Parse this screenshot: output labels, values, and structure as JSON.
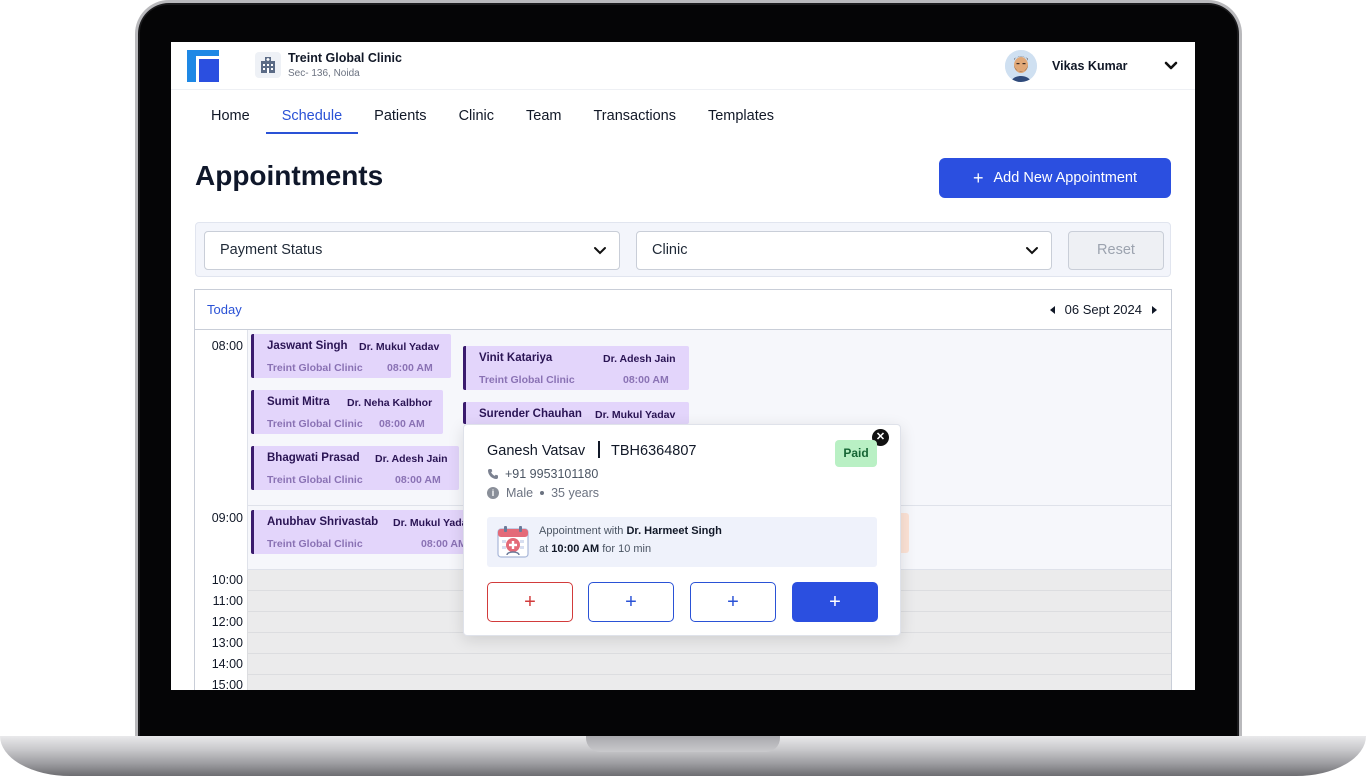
{
  "clinic": {
    "name": "Treint Global Clinic",
    "address": "Sec- 136, Noida"
  },
  "user": {
    "name": "Vikas Kumar"
  },
  "nav": [
    "Home",
    "Schedule",
    "Patients",
    "Clinic",
    "Team",
    "Transactions",
    "Templates"
  ],
  "active_nav": "Schedule",
  "page": {
    "title": "Appointments",
    "add_button": "Add New Appointment"
  },
  "filters": {
    "payment_status": "Payment Status",
    "clinic": "Clinic",
    "reset": "Reset"
  },
  "calendar": {
    "today_label": "Today",
    "date": "06 Sept 2024",
    "times": [
      "08:00",
      "09:00",
      "10:00",
      "11:00",
      "12:00",
      "13:00",
      "14:00",
      "15:00"
    ],
    "appointments": [
      {
        "patient": "Jaswant Singh",
        "doctor": "Dr. Mukul Yadav",
        "clinic": "Treint Global Clinic",
        "time": "08:00 AM"
      },
      {
        "patient": "Vinit Katariya",
        "doctor": "Dr. Adesh Jain",
        "clinic": "Treint Global Clinic",
        "time": "08:00 AM"
      },
      {
        "patient": "Sumit Mitra",
        "doctor": "Dr. Neha Kalbhor",
        "clinic": "Treint Global Clinic",
        "time": "08:00 AM"
      },
      {
        "patient": "Surender Chauhan",
        "doctor": "Dr. Mukul Yadav",
        "clinic": "",
        "time": ""
      },
      {
        "patient": "Bhagwati Prasad",
        "doctor": "Dr. Adesh Jain",
        "clinic": "Treint Global Clinic",
        "time": "08:00 AM"
      },
      {
        "patient": "Anubhav Shrivastab",
        "doctor": "Dr. Mukul Yada",
        "clinic": "Treint Global Clinic",
        "time": "08:00 AM"
      }
    ]
  },
  "popup": {
    "name": "Ganesh Vatsav",
    "id": "TBH6364807",
    "status": "Paid",
    "phone": "+91 9953101180",
    "gender": "Male",
    "age": "35 years",
    "appt_prefix": "Appointment with",
    "doctor": "Dr. Harmeet Singh",
    "at_prefix": "at",
    "time": "10:00 AM",
    "duration": "for 10 min",
    "buttons": [
      "+",
      "+",
      "+",
      "+"
    ]
  },
  "colors": {
    "accent": "#2b4fe0",
    "appointment_bg": "#e3d5fb",
    "paid_bg": "#b9f0c4"
  }
}
